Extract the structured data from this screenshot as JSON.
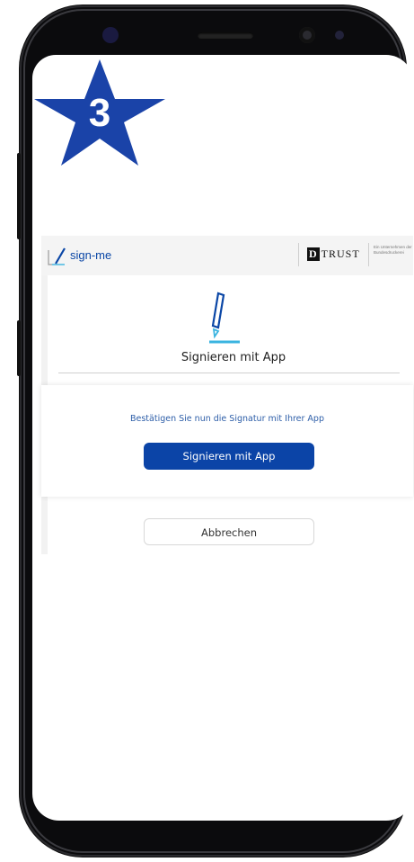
{
  "badge": {
    "number": "3",
    "color": "#1a43a8"
  },
  "header": {
    "logo_text": "sign-me",
    "partner_logo_prefix": "D",
    "partner_logo_text": "TRUST",
    "partner_note": "Ein Unternehmen der Bundesdruckerei"
  },
  "signing": {
    "title": "Signieren mit App",
    "message": "Bestätigen Sie nun die Signatur mit Ihrer App",
    "primary_button": "Signieren mit App",
    "cancel_button": "Abbrechen"
  },
  "colors": {
    "brand_blue": "#0b44a7",
    "accent_cyan": "#3ab4e0",
    "frame": "#0b0b0d"
  }
}
